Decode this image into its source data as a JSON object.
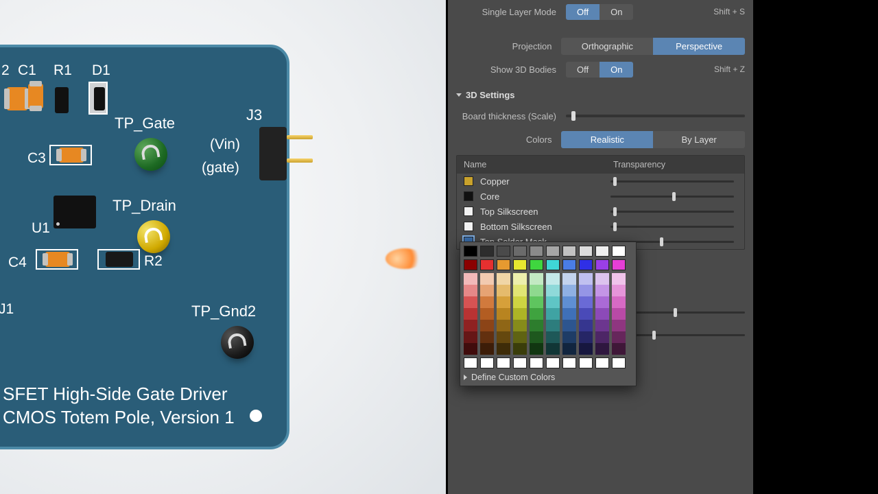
{
  "panel": {
    "singleLayer": {
      "label": "Single Layer Mode",
      "off": "Off",
      "on": "On",
      "active": "Off",
      "short": "Shift + S"
    },
    "projection": {
      "label": "Projection",
      "ortho": "Orthographic",
      "persp": "Perspective",
      "active": "Perspective"
    },
    "show3d": {
      "label": "Show 3D Bodies",
      "off": "Off",
      "on": "On",
      "active": "On",
      "short": "Shift + Z"
    },
    "section_3d": "3D Settings",
    "thickness": {
      "label": "Board thickness (Scale)",
      "pos": 3
    },
    "colorsRow": {
      "label": "Colors",
      "realistic": "Realistic",
      "byLayer": "By Layer",
      "active": "Realistic"
    },
    "tableHead": {
      "name": "Name",
      "trans": "Transparency"
    },
    "layers": [
      {
        "swatch": "#c9a22c",
        "name": "Copper",
        "pos": 2
      },
      {
        "swatch": "#111111",
        "name": "Core",
        "pos": 50
      },
      {
        "swatch": "#f2f2f2",
        "name": "Top Silkscreen",
        "pos": 2
      },
      {
        "swatch": "#f2f2f2",
        "name": "Bottom Silkscreen",
        "pos": 2
      },
      {
        "swatch": "#3a6fae",
        "name": "Top Solder Mask",
        "pos": 40,
        "selected": true
      }
    ],
    "lowerSliders": [
      {
        "pos": 42
      },
      {
        "pos": 25
      }
    ],
    "customColors": "Define Custom Colors"
  },
  "pcb": {
    "refs": {
      "c2": "2",
      "c1": "C1",
      "r1": "R1",
      "d1": "D1",
      "c3": "C3",
      "u1": "U1",
      "c4": "C4",
      "r2": "R2",
      "u_left": "J1",
      "tp_gate": "TP_Gate",
      "tp_drain": "TP_Drain",
      "tp_gnd2": "TP_Gnd2",
      "j3": "J3",
      "vin": "(Vin)",
      "gate": "(gate)"
    },
    "title1": "SFET High-Side Gate Driver",
    "title2": "CMOS Totem Pole, Version 1"
  },
  "picker": {
    "greys": [
      "#000000",
      "#2d2d2d",
      "#4a4a4a",
      "#6b6b6b",
      "#8a8a8a",
      "#a6a6a6",
      "#c2c2c2",
      "#dcdcdc",
      "#efefef",
      "#ffffff"
    ],
    "primaries": [
      "#8b0000",
      "#e63030",
      "#e69a30",
      "#e6e630",
      "#3fd63f",
      "#3fd6d6",
      "#4a7de6",
      "#2f2fe6",
      "#9a3fe6",
      "#e63fd6"
    ],
    "shadeFamilies": [
      [
        "#f2b9b9",
        "#e68888",
        "#d65353",
        "#b93333",
        "#8f2222",
        "#661616",
        "#400c0c"
      ],
      [
        "#f2cab0",
        "#e6a374",
        "#d17a3d",
        "#b35d22",
        "#8c4417",
        "#63300f",
        "#3d1d08"
      ],
      [
        "#f0d6a6",
        "#e5bb6c",
        "#d6a03a",
        "#b88420",
        "#8f6616",
        "#65480e",
        "#3e2c08"
      ],
      [
        "#edefac",
        "#e1e574",
        "#ced442",
        "#adb426",
        "#868b1b",
        "#5f6312",
        "#3a3d0a"
      ],
      [
        "#c3e9c3",
        "#8fd98f",
        "#5fc55f",
        "#3fa33f",
        "#2d7d2d",
        "#1e581e",
        "#113611"
      ],
      [
        "#c3e9e9",
        "#8fd9d9",
        "#5fc5c5",
        "#3fa3a3",
        "#2d7d7d",
        "#1e5858",
        "#113636"
      ],
      [
        "#c3d3ee",
        "#8fb0e3",
        "#5f8fd3",
        "#3f70b8",
        "#2d558f",
        "#1e3c66",
        "#11253f"
      ],
      [
        "#c0c0f0",
        "#9595e6",
        "#6a6ad6",
        "#4a4ab8",
        "#36368f",
        "#262666",
        "#17173f"
      ],
      [
        "#dcc3ee",
        "#c495e6",
        "#aa6ad6",
        "#8c4ab8",
        "#6c368f",
        "#4d2666",
        "#2f173f"
      ],
      [
        "#f0c3ea",
        "#e695d9",
        "#d66ac4",
        "#b84aa6",
        "#8f3680",
        "#66265b",
        "#3f1738"
      ]
    ],
    "bottomRow": [
      "#ffffff",
      "#ffffff",
      "#ffffff",
      "#ffffff",
      "#ffffff",
      "#ffffff",
      "#ffffff",
      "#ffffff",
      "#ffffff",
      "#ffffff"
    ]
  }
}
